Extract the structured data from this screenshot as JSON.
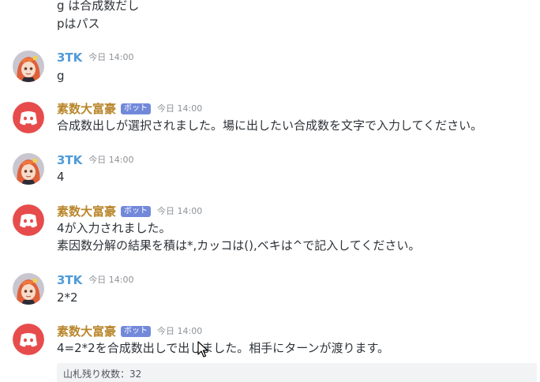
{
  "messages": [
    {
      "lines": [
        "g は合成数だし",
        "pはパス"
      ]
    },
    {
      "author": "3TK",
      "time": "今日 14:00",
      "lines": [
        "g"
      ]
    },
    {
      "author": "素数大富豪",
      "bot_tag": "ボット",
      "time": "今日 14:00",
      "lines": [
        "合成数出しが選択されました。場に出したい合成数を文字で入力してください。"
      ]
    },
    {
      "author": "3TK",
      "time": "今日 14:00",
      "lines": [
        "4"
      ]
    },
    {
      "author": "素数大富豪",
      "bot_tag": "ボット",
      "time": "今日 14:00",
      "lines": [
        "4が入力されました。",
        "素因数分解の結果を積は*,カッコは(),ベキは^で記入してください。"
      ]
    },
    {
      "author": "3TK",
      "time": "今日 14:00",
      "lines": [
        "2*2"
      ]
    },
    {
      "author": "素数大富豪",
      "bot_tag": "ボット",
      "time": "今日 14:00",
      "lines": [
        "4=2*2を合成数出しで出しました。相手にターンが渡ります。"
      ],
      "embed": "山札残り枚数：32"
    }
  ],
  "colors": {
    "user_name": "#4f9bd9",
    "bot_name": "#b8862b",
    "bot_tag_bg": "#7289da",
    "discord_red": "#e74c4c",
    "embed_bg": "#f2f3f5"
  },
  "icons": {
    "user_avatar": "anime-character-avatar",
    "bot_avatar": "discord-logo-icon",
    "cursor": "mouse-pointer-icon"
  }
}
